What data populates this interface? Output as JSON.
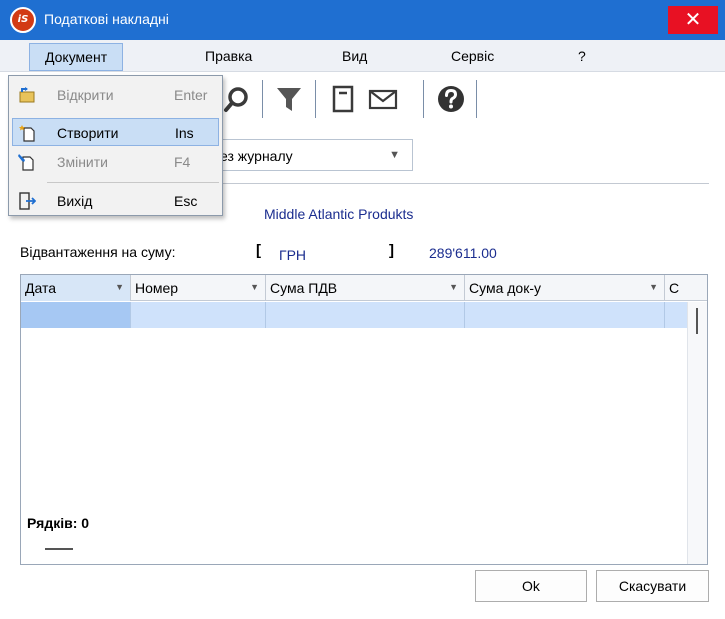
{
  "window": {
    "title": "Податкові накладні",
    "logo_text": "iS",
    "close_symbol": "✕"
  },
  "menubar": {
    "items": [
      "Документ",
      "Правка",
      "Вид",
      "Сервіс",
      "?"
    ]
  },
  "document_menu": {
    "items": [
      {
        "label": "Відкрити",
        "shortcut": "Enter",
        "enabled": false,
        "icon": "open-icon"
      },
      {
        "label": "Створити",
        "shortcut": "Ins",
        "enabled": true,
        "icon": "new-document-icon"
      },
      {
        "label": "Змінити",
        "shortcut": "F4",
        "enabled": false,
        "icon": "edit-icon"
      },
      {
        "label": "Вихід",
        "shortcut": "Esc",
        "enabled": true,
        "icon": "exit-icon"
      }
    ]
  },
  "toolbar": {
    "icons": [
      "search-icon",
      "filter-icon",
      "document-icon",
      "mail-icon",
      "help-icon"
    ]
  },
  "journal": {
    "visible_text": "ез журналу"
  },
  "partner": {
    "name": "Middle Atlantic Produkts"
  },
  "shipment": {
    "label": "Відвантаження на суму:",
    "bracket_open": "[",
    "bracket_close": "]",
    "currency": "ГРН",
    "amount": "289'611.00"
  },
  "grid": {
    "columns": [
      "Дата",
      "Номер",
      "Сума ПДВ",
      "Сума док-у",
      "С"
    ],
    "rows_label": "Рядків: 0"
  },
  "buttons": {
    "ok": "Ok",
    "cancel": "Скасувати"
  },
  "colors": {
    "titlebar": "#1f6fd1",
    "close": "#e81123",
    "selection": "#c9def5",
    "link_text": "#1b2d8f"
  }
}
